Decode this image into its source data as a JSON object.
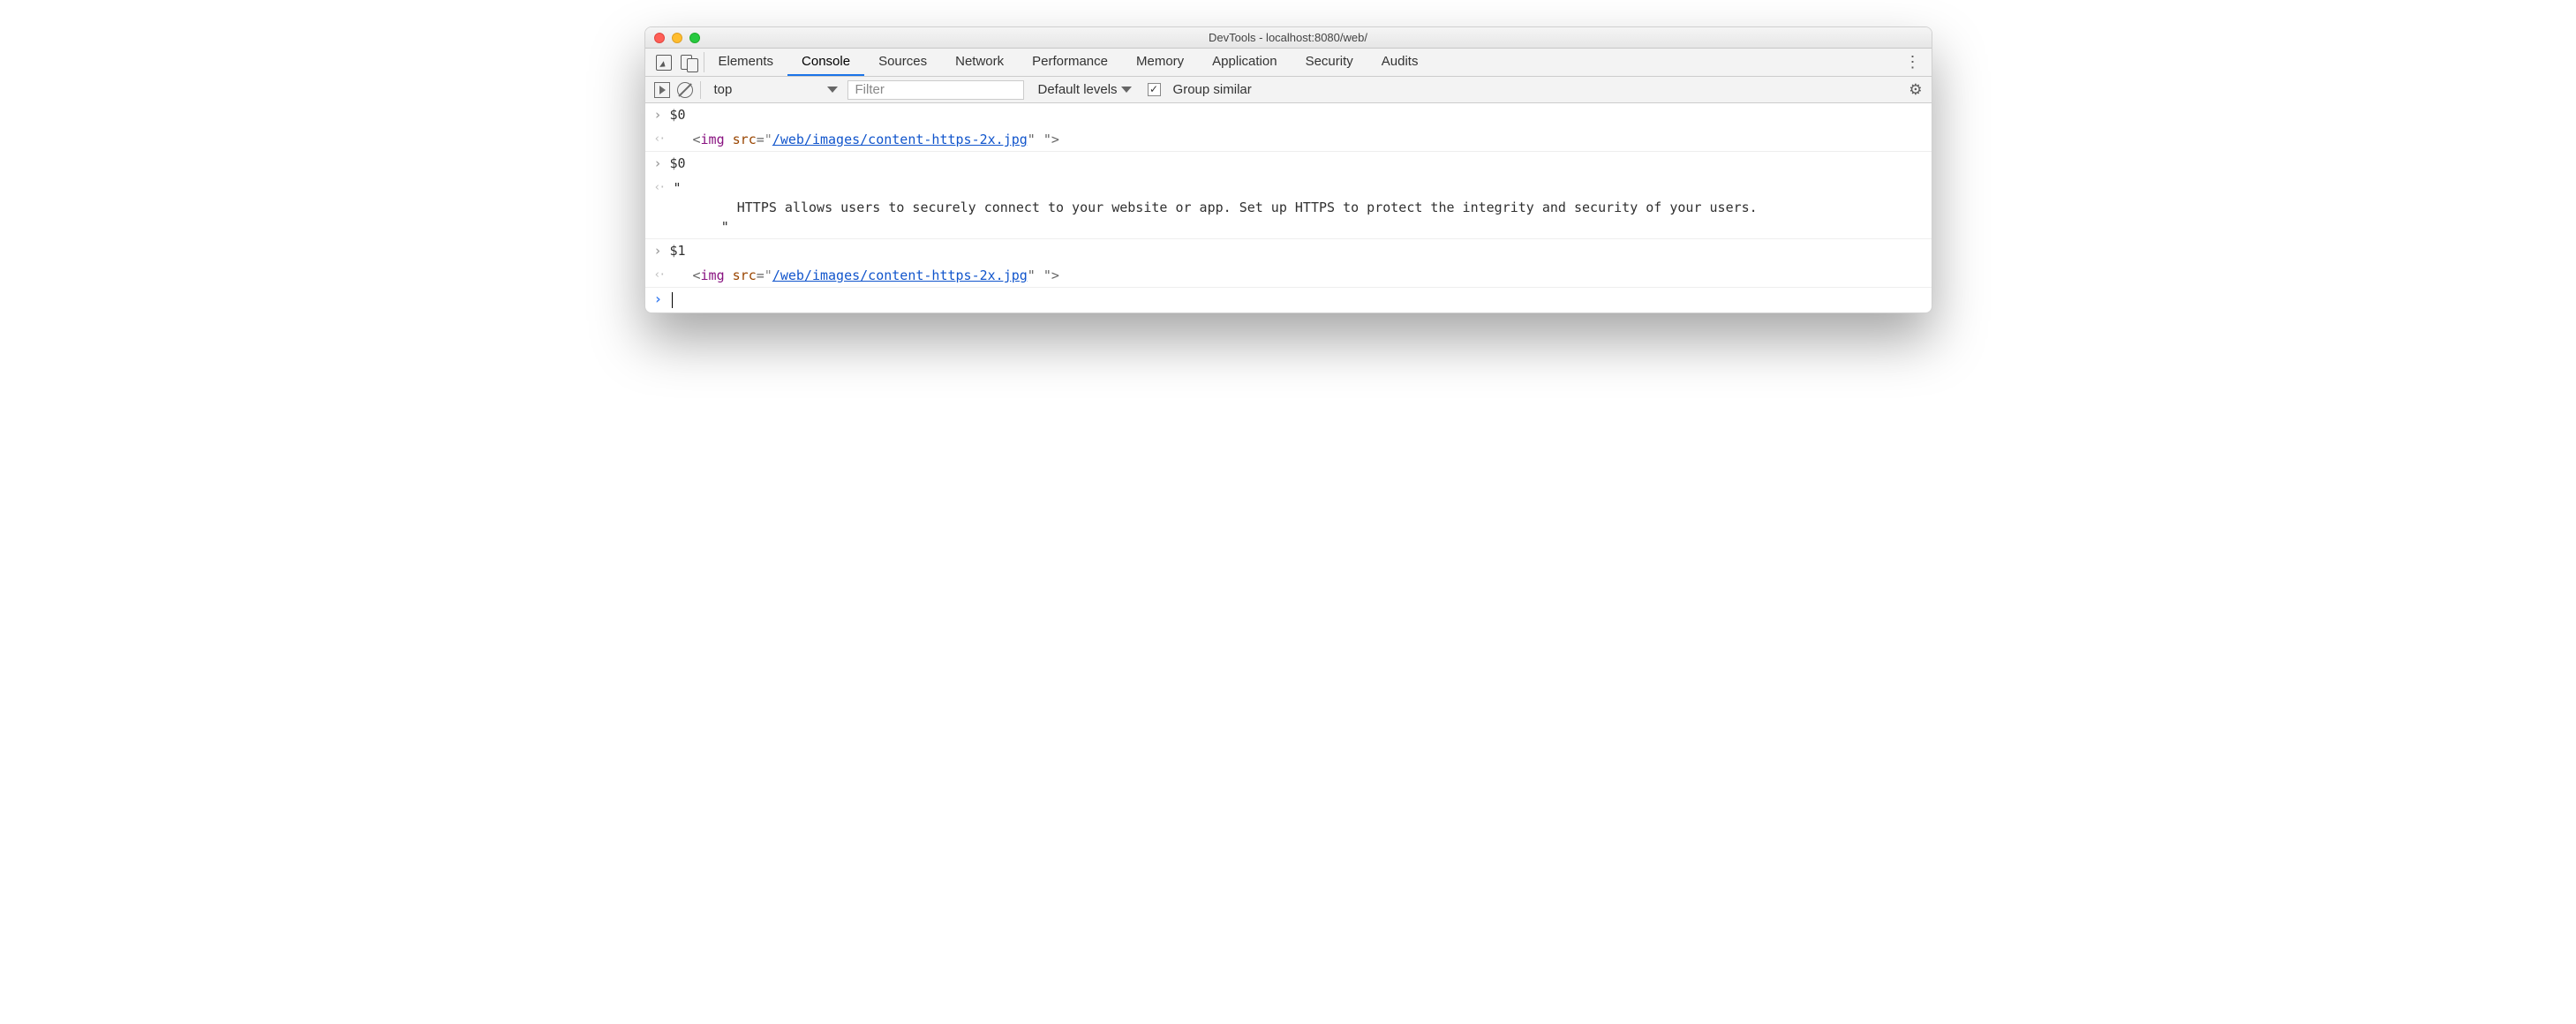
{
  "window": {
    "title": "DevTools - localhost:8080/web/"
  },
  "tabs": {
    "items": [
      "Elements",
      "Console",
      "Sources",
      "Network",
      "Performance",
      "Memory",
      "Application",
      "Security",
      "Audits"
    ],
    "active": "Console"
  },
  "toolbar": {
    "context": "top",
    "filter_placeholder": "Filter",
    "levels_label": "Default levels",
    "group_similar_label": "Group similar",
    "group_similar_checked": true
  },
  "console": {
    "entries": [
      {
        "kind": "input",
        "text": "$0"
      },
      {
        "kind": "output_img",
        "indent": true,
        "parts": {
          "open": "<",
          "tag": "img",
          "attr": "src",
          "eq": "=",
          "q": "\"",
          "url": "/web/images/content-https-2x.jpg",
          "tail": "\" \">"
        }
      },
      {
        "kind": "input",
        "text": "$0"
      },
      {
        "kind": "output_text",
        "text": "\"\n        HTTPS allows users to securely connect to your website or app. Set up HTTPS to protect the integrity and security of your users.\n      \""
      },
      {
        "kind": "input",
        "text": "$1"
      },
      {
        "kind": "output_img",
        "indent": true,
        "parts": {
          "open": "<",
          "tag": "img",
          "attr": "src",
          "eq": "=",
          "q": "\"",
          "url": "/web/images/content-https-2x.jpg",
          "tail": "\" \">"
        }
      }
    ]
  }
}
